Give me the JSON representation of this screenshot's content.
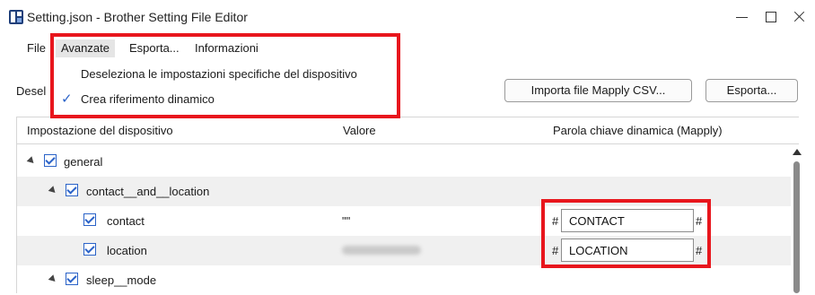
{
  "window": {
    "title": "Setting.json - Brother Setting File Editor",
    "controls": [
      "minimize",
      "maximize",
      "close"
    ]
  },
  "menubar": {
    "items": [
      {
        "label": "File"
      },
      {
        "label": "Avanzate"
      },
      {
        "label": "Esporta..."
      },
      {
        "label": "Informazioni"
      }
    ],
    "open_menu": "Avanzate"
  },
  "dropdown": {
    "items": [
      {
        "label": "Deseleziona le impostazioni specifiche del dispositivo",
        "checked": false
      },
      {
        "label": "Crea riferimento dinamico",
        "checked": true
      }
    ]
  },
  "toolbar": {
    "deselect_partial_label": "Desel",
    "import_button": "Importa file Mapply CSV...",
    "export_button": "Esporta..."
  },
  "grid": {
    "headers": {
      "setting": "Impostazione del dispositivo",
      "value": "Valore",
      "keyword": "Parola chiave dinamica (Mapply)"
    },
    "rows": [
      {
        "label": "general",
        "checked": true,
        "expanded": true,
        "value": "",
        "keyword": null
      },
      {
        "label": "contact__and__location",
        "checked": true,
        "expanded": true,
        "value": "",
        "keyword": null
      },
      {
        "label": "contact",
        "checked": true,
        "value": "\"\"",
        "keyword": "CONTACT",
        "hash": "#"
      },
      {
        "label": "location",
        "checked": true,
        "value": "[blurred]",
        "keyword": "LOCATION",
        "hash": "#"
      },
      {
        "label": "sleep__mode",
        "checked": true,
        "expanded": true,
        "value": "",
        "keyword": null
      }
    ]
  },
  "colors": {
    "accent": "#2b63c8",
    "highlight": "#e8161d",
    "menu_hover": "#e5e5e5",
    "alt_row": "#f0f0f0"
  }
}
